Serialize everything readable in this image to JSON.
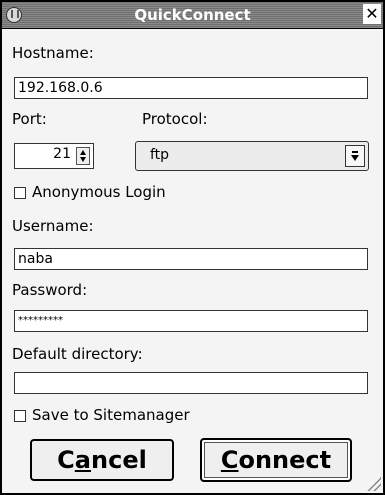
{
  "window": {
    "title": "QuickConnect",
    "close_glyph": "✕"
  },
  "hostname": {
    "label": "Hostname:",
    "value": "192.168.0.6"
  },
  "port": {
    "label": "Port:",
    "value": "21"
  },
  "protocol": {
    "label": "Protocol:",
    "value": "ftp"
  },
  "anonymous": {
    "label": "Anonymous Login",
    "checked": false
  },
  "username": {
    "label": "Username:",
    "value": "naba"
  },
  "password": {
    "label": "Password:",
    "value": "*********"
  },
  "default_directory": {
    "label": "Default directory:",
    "value": ""
  },
  "save_sitemanager": {
    "label": "Save to Sitemanager",
    "checked": false
  },
  "buttons": {
    "cancel": {
      "prefix": "C",
      "mnemonic": "a",
      "suffix": "ncel"
    },
    "connect": {
      "prefix": "",
      "mnemonic": "C",
      "suffix": "onnect"
    }
  },
  "icons": {
    "app": "app-icon",
    "close": "close-icon",
    "resize": "resize-grip-icon"
  }
}
